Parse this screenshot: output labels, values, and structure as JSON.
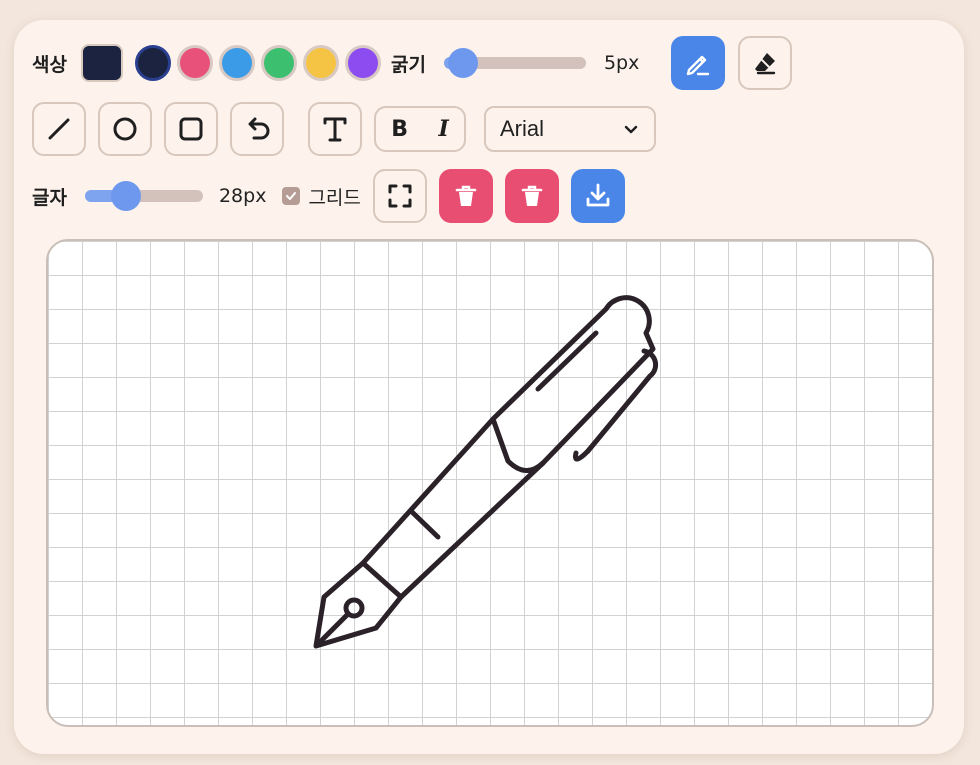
{
  "toolbar": {
    "color_label": "색상",
    "current_color": "#1c2340",
    "palette": [
      {
        "name": "navy",
        "hex": "#1c2340",
        "selected": true
      },
      {
        "name": "pink",
        "hex": "#e8527a",
        "selected": false
      },
      {
        "name": "blue",
        "hex": "#3b9be6",
        "selected": false
      },
      {
        "name": "green",
        "hex": "#3cbf6e",
        "selected": false
      },
      {
        "name": "yellow",
        "hex": "#f6c445",
        "selected": false
      },
      {
        "name": "purple",
        "hex": "#8c4cf0",
        "selected": false
      }
    ],
    "thickness_label": "굵기",
    "thickness_value": "5px",
    "thickness_fraction": 0.15,
    "pen_tool": "pen-icon",
    "eraser_tool": "eraser-icon"
  },
  "shapes": {
    "tools": [
      "line-icon",
      "circle-icon",
      "square-icon",
      "undo-icon",
      "text-icon"
    ],
    "bold_label": "B",
    "italic_label": "I",
    "font_value": "Arial"
  },
  "text_row": {
    "size_label": "글자",
    "size_value": "28px",
    "size_fraction": 0.3,
    "grid_label": "그리드",
    "grid_checked": true,
    "actions": [
      "fullscreen-icon",
      "trash-icon",
      "trash-icon",
      "download-icon"
    ]
  },
  "colors": {
    "accent_blue": "#4a86e8",
    "danger_pink": "#e84d72",
    "slider_fill": "#6e98ee"
  }
}
